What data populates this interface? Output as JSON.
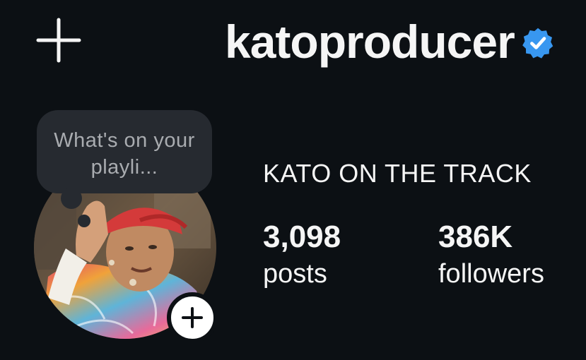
{
  "header": {
    "create_icon": "plus-icon",
    "username": "katoproducer",
    "verified_icon": "verified-badge-icon",
    "verified_color": "#3897f0"
  },
  "note": {
    "text": "What's on your playli..."
  },
  "profile": {
    "avatar_icon": "profile-photo",
    "add_story_icon": "plus-icon",
    "display_name": "KATO ON THE TRACK"
  },
  "stats": [
    {
      "value": "3,098",
      "label": "posts"
    },
    {
      "value": "386K",
      "label": "followers"
    }
  ],
  "colors": {
    "background": "#0c1014",
    "text": "#f5f5f5",
    "note_bubble": "#262a30",
    "note_text": "#a9acb0"
  }
}
